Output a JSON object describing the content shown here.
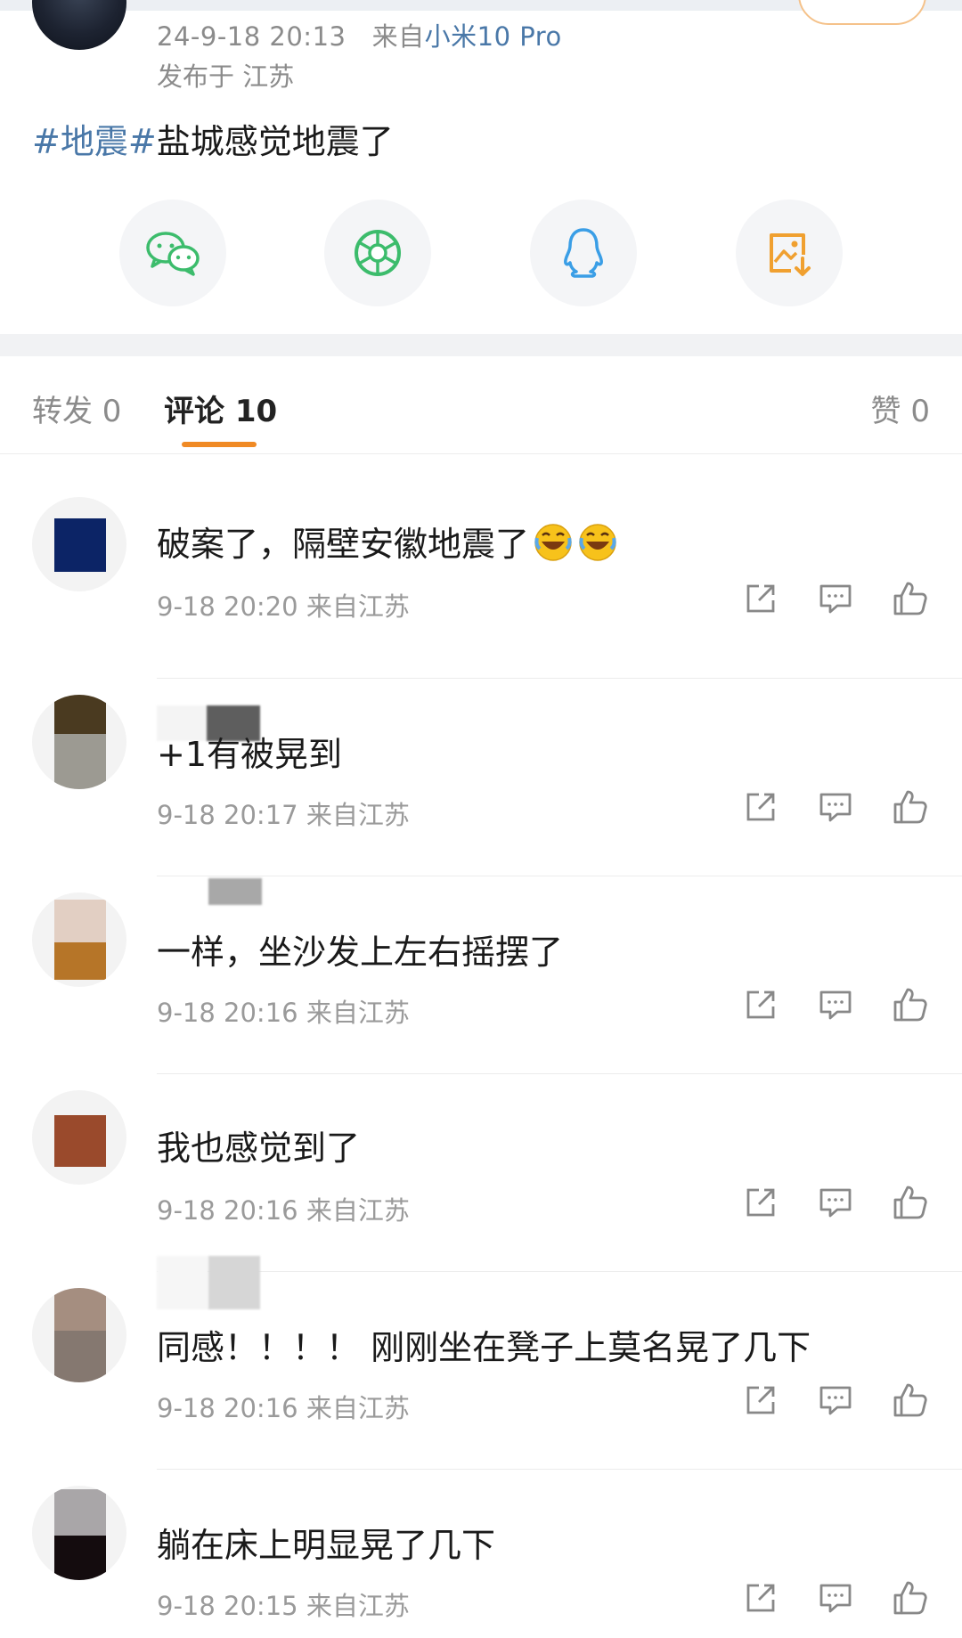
{
  "post": {
    "time": "24-9-18 20:13",
    "source_prefix": "来自",
    "device": "小米10 Pro",
    "location": "发布于 江苏",
    "hashtag": "#地震#",
    "text": "盐城感觉地震了"
  },
  "share": [
    {
      "name": "wechat",
      "icon": "wechat-icon",
      "color": "#3cbc6c"
    },
    {
      "name": "moments",
      "icon": "moments-shutter-icon",
      "color": "#3cbc6c"
    },
    {
      "name": "qq",
      "icon": "qq-penguin-icon",
      "color": "#3a9ee6"
    },
    {
      "name": "save-image",
      "icon": "save-image-icon",
      "color": "#f0a030"
    }
  ],
  "tabs": {
    "forward": "转发 0",
    "comment": "评论 10",
    "like": "赞 0"
  },
  "comments": [
    {
      "text": "破案了，隔壁安徽地震了",
      "emoji": "laugh-cry-emoji",
      "time": "9-18 20:20 来自江苏"
    },
    {
      "text": "+1有被晃到",
      "time": "9-18 20:17 来自江苏"
    },
    {
      "text": "一样，坐沙发上左右摇摆了",
      "time": "9-18 20:16 来自江苏"
    },
    {
      "text": "我也感觉到了",
      "time": "9-18 20:16 来自江苏"
    },
    {
      "text": "同感！！！！ 刚刚坐在凳子上莫名晃了几下",
      "time": "9-18 20:16 来自江苏"
    },
    {
      "text": "躺在床上明显晃了几下",
      "time": "9-18 20:15 来自江苏"
    }
  ],
  "icons": {
    "forward": "share-arrow-icon",
    "reply": "comment-bubble-icon",
    "like": "thumbs-up-icon"
  },
  "colors": {
    "accent": "#f08a24",
    "link": "#4a78a8",
    "meta": "#9a9a9a"
  }
}
